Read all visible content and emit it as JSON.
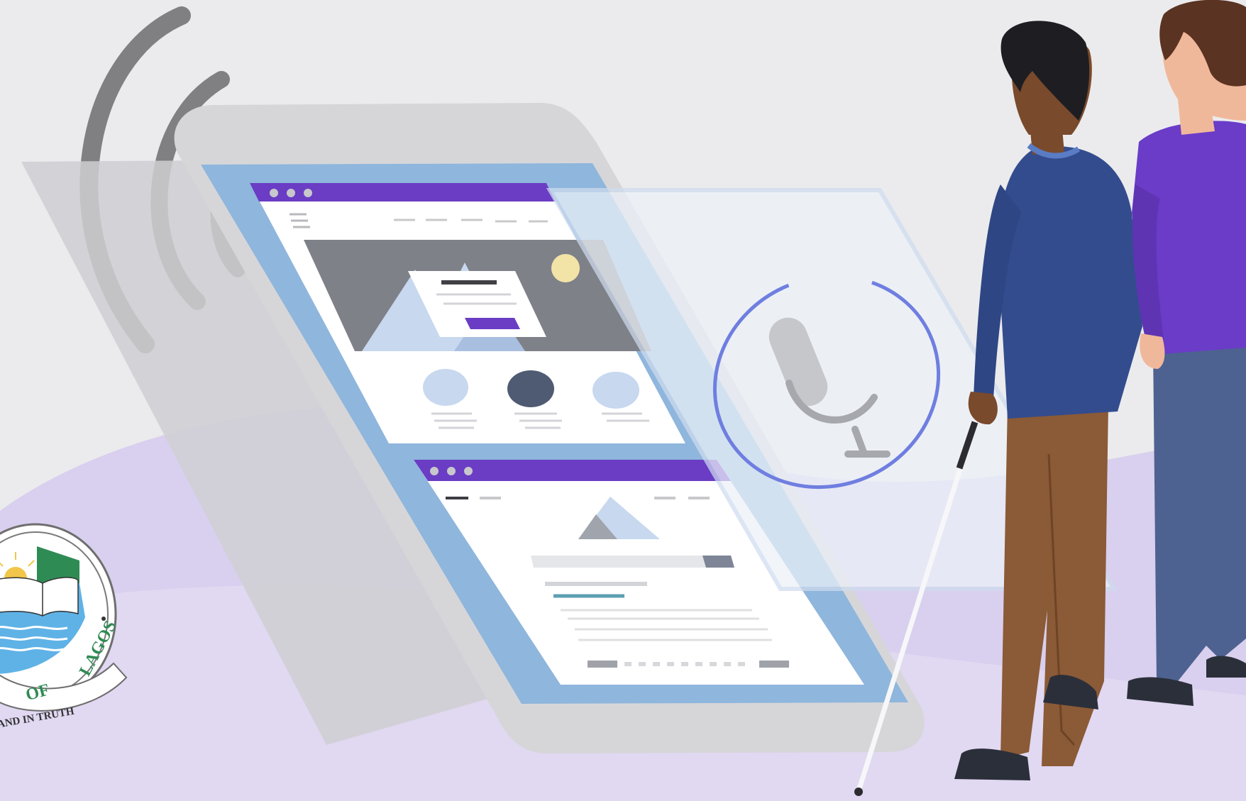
{
  "illustration": {
    "logo_text": {
      "of": "OF",
      "lagos": "LAGOS",
      "motto": "IN DEED AND IN TRUTH",
      "motto_visible": "AND IN TRUTH"
    },
    "colors": {
      "background": "#ebebed",
      "purple_floor": "#d9cfee",
      "phone_shell": "#cfcfd2",
      "screen_blue": "#8fb6dc",
      "browser_bar": "#6a3dc4",
      "mic_ring": "#6f7ee0",
      "man_sweater": "#334c8e",
      "man_pants": "#8b5a36",
      "woman_shirt": "#6a3cc8",
      "woman_pants": "#4d6290",
      "logo_green": "#2f8b54",
      "logo_water": "#5fb2e6"
    },
    "icons": [
      "sound-waves-icon",
      "microphone-icon",
      "university-seal-logo",
      "white-cane-icon"
    ]
  }
}
